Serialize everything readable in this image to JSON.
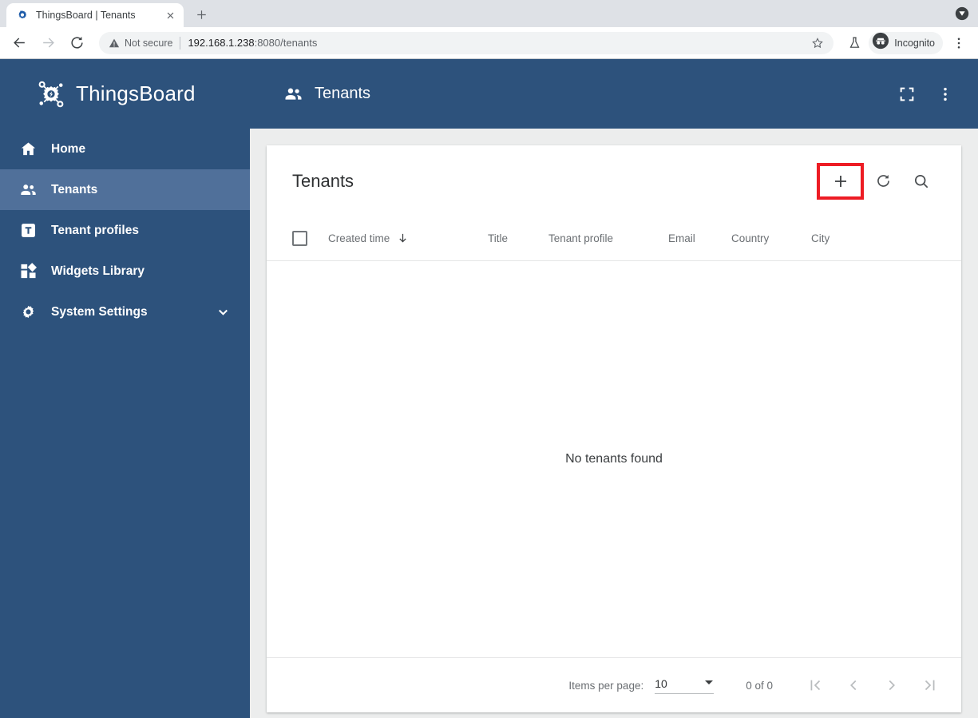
{
  "browser": {
    "tab": {
      "title": "ThingsBoard | Tenants",
      "favicon_icon": "thingsboard-gear-favicon",
      "close_icon": "close-icon"
    },
    "new_tab_icon": "plus-icon",
    "window_control_icon": "window-control-icon",
    "nav": {
      "back_icon": "arrow-back-icon",
      "forward_icon": "arrow-forward-icon",
      "reload_icon": "reload-icon"
    },
    "omnibox": {
      "security_icon": "not-secure-warning-icon",
      "security_text": "Not secure",
      "url_host": "192.168.1.238",
      "url_path": ":8080/tenants",
      "bookmark_icon": "star-icon"
    },
    "toolbar_icons": {
      "experiment_icon": "flask-icon",
      "menu_icon": "three-dot-menu-icon"
    },
    "incognito": {
      "label": "Incognito",
      "icon": "incognito-hat-icon"
    }
  },
  "sidebar": {
    "logo_icon": "thingsboard-logo-icon",
    "logo_text": "ThingsBoard",
    "items": [
      {
        "label": "Home",
        "icon": "home-icon",
        "active": false,
        "expandable": false
      },
      {
        "label": "Tenants",
        "icon": "people-icon",
        "active": true,
        "expandable": false
      },
      {
        "label": "Tenant profiles",
        "icon": "tenant-profile-icon",
        "active": false,
        "expandable": false
      },
      {
        "label": "Widgets Library",
        "icon": "widgets-icon",
        "active": false,
        "expandable": false
      },
      {
        "label": "System Settings",
        "icon": "gear-icon",
        "active": false,
        "expandable": true
      }
    ],
    "expand_icon": "chevron-down-icon"
  },
  "toolbar": {
    "icon": "people-icon",
    "title": "Tenants",
    "fullscreen_icon": "fullscreen-icon",
    "menu_icon": "three-dot-menu-icon"
  },
  "card": {
    "title": "Tenants",
    "actions": {
      "add_icon": "plus-icon",
      "refresh_icon": "refresh-icon",
      "search_icon": "search-icon"
    },
    "highlight_color": "#ed1c24",
    "columns": [
      {
        "label": "Created time",
        "sorted": true,
        "sort_icon": "arrow-down-icon"
      },
      {
        "label": "Title",
        "sorted": false
      },
      {
        "label": "Tenant profile",
        "sorted": false
      },
      {
        "label": "Email",
        "sorted": false
      },
      {
        "label": "Country",
        "sorted": false
      },
      {
        "label": "City",
        "sorted": false
      }
    ],
    "select_all_checkbox": "unchecked",
    "empty_message": "No tenants found",
    "paginator": {
      "items_per_page_label": "Items per page:",
      "items_per_page_value": "10",
      "dropdown_icon": "dropdown-arrow-icon",
      "range_label": "0 of 0",
      "first_page_icon": "first-page-icon",
      "prev_page_icon": "prev-page-icon",
      "next_page_icon": "next-page-icon",
      "last_page_icon": "last-page-icon"
    }
  },
  "colors": {
    "brand_blue": "#2d527c",
    "active_nav": "#50709a",
    "page_bg": "#eceded",
    "highlight_red": "#ed1c24"
  }
}
